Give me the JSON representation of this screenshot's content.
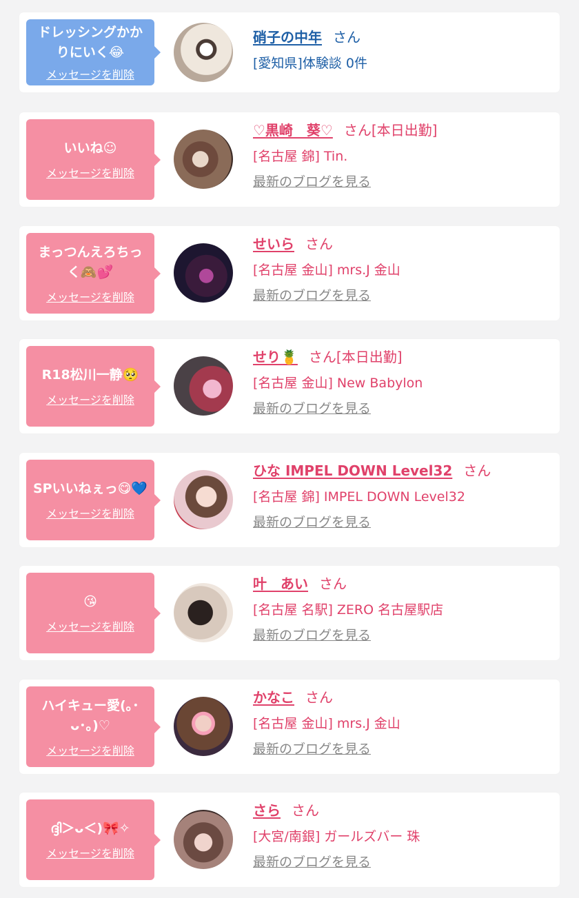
{
  "delete_label": "メッセージを削除",
  "san_label": "さん",
  "blog_label": "最新のブログを見る",
  "colors": {
    "blue_accent": "#7aa9ea",
    "pink_accent": "#f58fa3",
    "blue_text": "#1e5fa6",
    "pink_text": "#e0416a",
    "gray_link": "#888888"
  },
  "items": [
    {
      "message": "ドレッシングかかりにいく😂",
      "name": "硝子の中年",
      "suffix": "",
      "sub": "[愛知県]体験談 0件",
      "blog": false,
      "theme": "blue"
    },
    {
      "message": "いいね☺",
      "name": "♡黒崎　葵♡",
      "suffix": "[本日出勤]",
      "sub": "[名古屋 錦] Tin.",
      "blog": true,
      "theme": "pink"
    },
    {
      "message": "まっつんえろちっく🙈💕",
      "name": "せいら",
      "suffix": "",
      "sub": "[名古屋 金山] mrs.J 金山",
      "blog": true,
      "theme": "pink"
    },
    {
      "message": "R18松川一静🥺",
      "name": "せり🍍",
      "suffix": "[本日出勤]",
      "sub": "[名古屋 金山] New Babylon",
      "blog": true,
      "theme": "pink"
    },
    {
      "message": "SPいいねぇっ😋💙",
      "name": "ひな IMPEL DOWN Level32",
      "suffix": "",
      "sub": "[名古屋 錦] IMPEL DOWN Level32",
      "blog": true,
      "theme": "pink"
    },
    {
      "message": "😘",
      "name": "叶　あい",
      "suffix": "",
      "sub": "[名古屋 名駅] ZERO 名古屋駅店",
      "blog": true,
      "theme": "pink"
    },
    {
      "message": "ハイキュー愛(｡･ᴗ･｡)♡",
      "name": "かなこ",
      "suffix": "",
      "sub": "[名古屋 金山] mrs.J 金山",
      "blog": true,
      "theme": "pink"
    },
    {
      "message": "ദ്ദി＞ᴗ＜)🎀✧",
      "name": "さら",
      "suffix": "",
      "sub": "[大宮/南銀] ガールズバー 珠",
      "blog": true,
      "theme": "pink"
    }
  ]
}
